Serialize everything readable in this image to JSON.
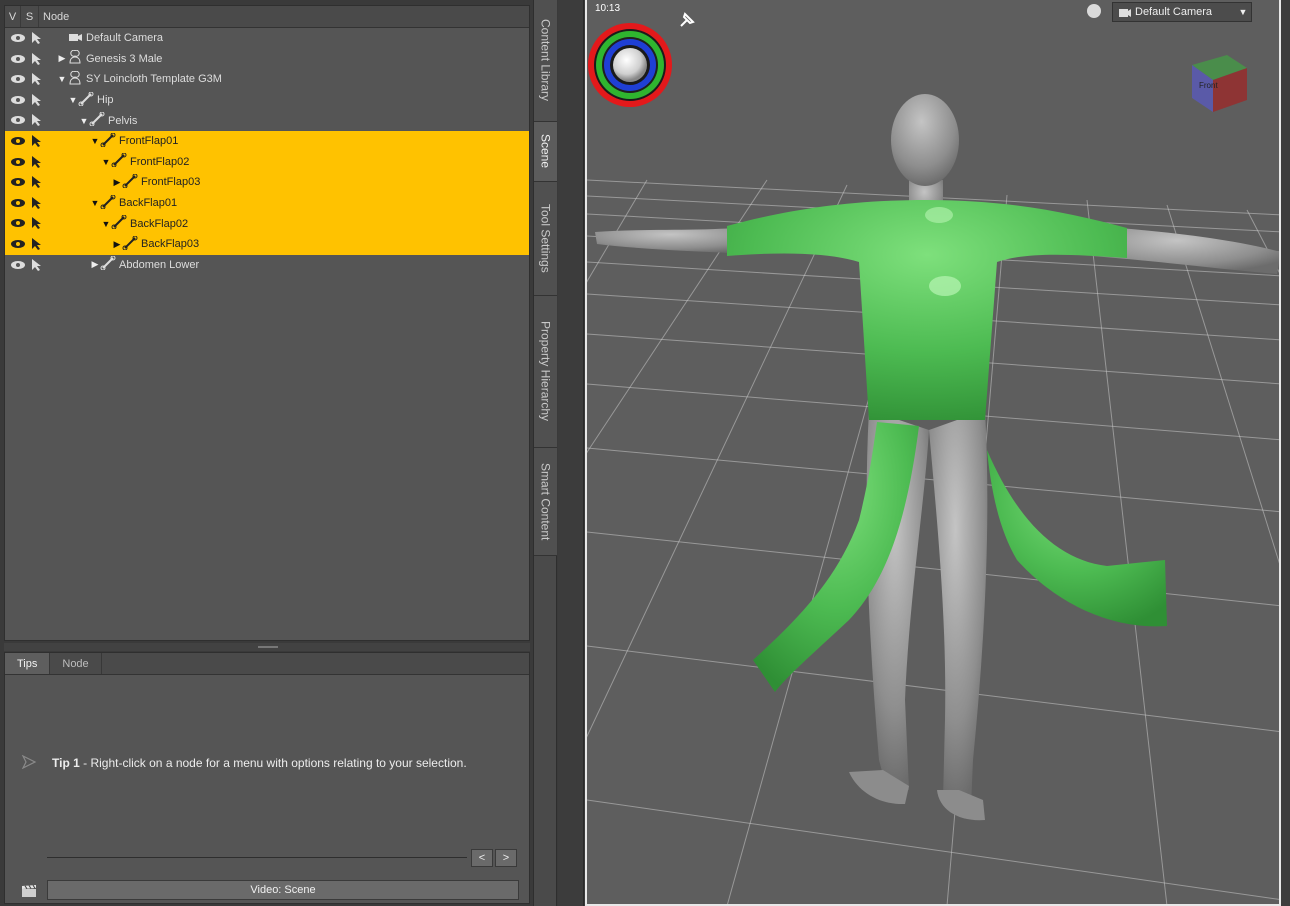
{
  "scene": {
    "header": {
      "v": "V",
      "s": "S",
      "node": "Node"
    },
    "nodes": [
      {
        "label": "Default Camera",
        "icon": "camera-icon",
        "indent": 0,
        "expander": "",
        "selected": false
      },
      {
        "label": "Genesis 3 Male",
        "icon": "figure-icon",
        "indent": 0,
        "expander": "▶",
        "selected": false
      },
      {
        "label": "SY Loincloth Template G3M",
        "icon": "figure-icon",
        "indent": 0,
        "expander": "▼",
        "selected": false
      },
      {
        "label": "Hip",
        "icon": "bone-icon",
        "indent": 1,
        "expander": "▼",
        "selected": false
      },
      {
        "label": "Pelvis",
        "icon": "bone-icon",
        "indent": 2,
        "expander": "▼",
        "selected": false
      },
      {
        "label": "FrontFlap01",
        "icon": "bone-icon",
        "indent": 3,
        "expander": "▼",
        "selected": true
      },
      {
        "label": "FrontFlap02",
        "icon": "bone-icon",
        "indent": 4,
        "expander": "▼",
        "selected": true
      },
      {
        "label": "FrontFlap03",
        "icon": "bone-icon",
        "indent": 5,
        "expander": "▶",
        "selected": true
      },
      {
        "label": "BackFlap01",
        "icon": "bone-icon",
        "indent": 3,
        "expander": "▼",
        "selected": true
      },
      {
        "label": "BackFlap02",
        "icon": "bone-icon",
        "indent": 4,
        "expander": "▼",
        "selected": true
      },
      {
        "label": "BackFlap03",
        "icon": "bone-icon",
        "indent": 5,
        "expander": "▶",
        "selected": true
      },
      {
        "label": "Abdomen Lower",
        "icon": "bone-icon",
        "indent": 3,
        "expander": "▶",
        "selected": false
      }
    ]
  },
  "side_tabs": [
    {
      "label": "Content Library",
      "active": false
    },
    {
      "label": "Scene",
      "active": true
    },
    {
      "label": "Tool Settings",
      "active": false
    },
    {
      "label": "Property Hierarchy",
      "active": false
    },
    {
      "label": "Smart Content",
      "active": false
    }
  ],
  "tips": {
    "tabs": [
      {
        "label": "Tips",
        "active": true
      },
      {
        "label": "Node",
        "active": false
      }
    ],
    "tip_number": "Tip 1",
    "tip_body": " - Right-click on a node for a menu with options relating to your selection.",
    "prev": "<",
    "next": ">",
    "video_button": "Video: Scene"
  },
  "viewport": {
    "camera": "Default Camera",
    "fps_counter": "10:13",
    "cube_face": "Front",
    "colors": {
      "background": "#5e5e5e",
      "grid": "#c8c8c8",
      "skin": "#9a9a9a",
      "cloth": "#56c25a",
      "selection_highlight": "#ffc200"
    }
  }
}
